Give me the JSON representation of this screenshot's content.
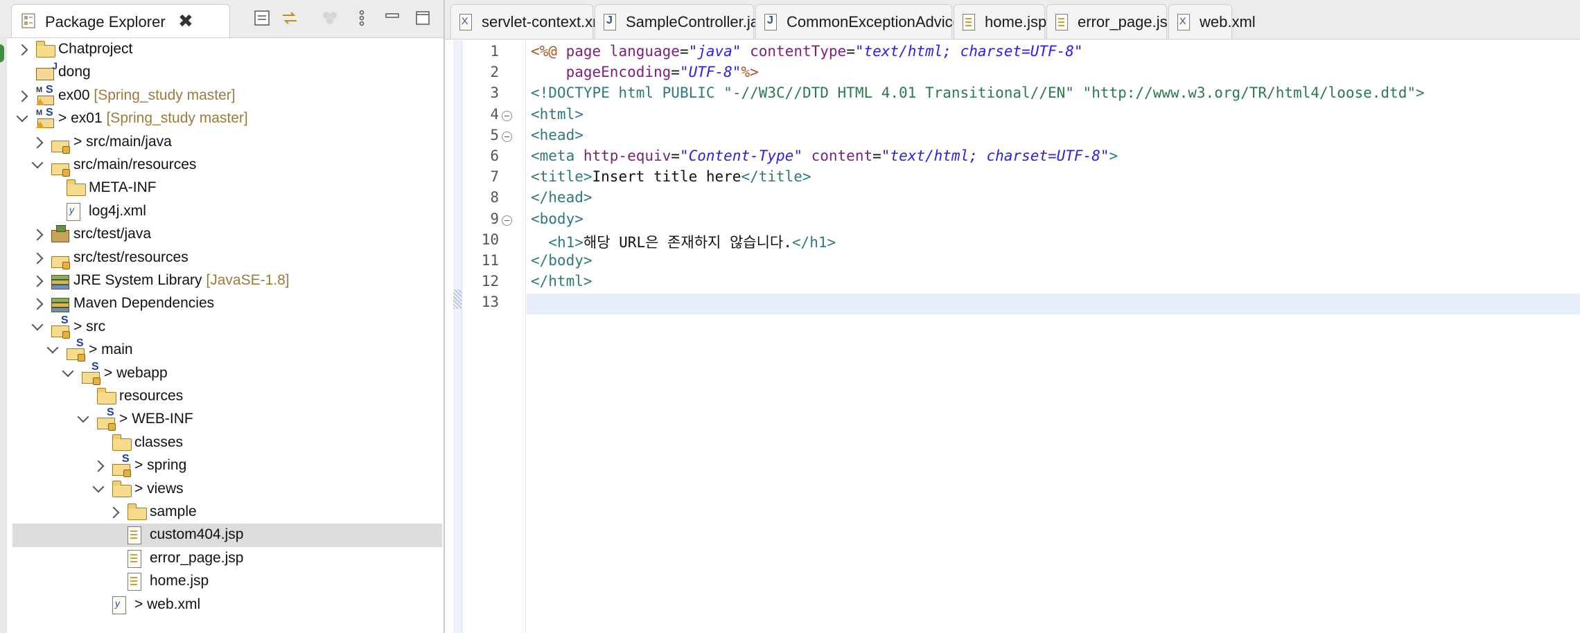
{
  "package_explorer": {
    "title": "Package Explorer",
    "tree": [
      {
        "label": "Chatproject",
        "suffix": "",
        "icon": "project-folder-icon",
        "depth": 0,
        "state": "collapsed"
      },
      {
        "label": "dong",
        "suffix": "",
        "icon": "java-project-icon",
        "depth": 0,
        "state": "none"
      },
      {
        "label": "ex00",
        "suffix": "[Spring_study master]",
        "icon": "maven-spring-project-icon",
        "depth": 0,
        "state": "collapsed"
      },
      {
        "label": "> ex01",
        "suffix": "[Spring_study master]",
        "icon": "maven-spring-project-icon",
        "depth": 0,
        "state": "expanded"
      },
      {
        "label": "> src/main/java",
        "suffix": "",
        "icon": "source-folder-icon",
        "depth": 1,
        "state": "collapsed"
      },
      {
        "label": "src/main/resources",
        "suffix": "",
        "icon": "source-folder-icon",
        "depth": 1,
        "state": "expanded"
      },
      {
        "label": "META-INF",
        "suffix": "",
        "icon": "folder-icon",
        "depth": 2,
        "state": "none"
      },
      {
        "label": "log4j.xml",
        "suffix": "",
        "icon": "xml-file-icon",
        "depth": 2,
        "state": "none"
      },
      {
        "label": "src/test/java",
        "suffix": "",
        "icon": "package-root-icon",
        "depth": 1,
        "state": "collapsed"
      },
      {
        "label": "src/test/resources",
        "suffix": "",
        "icon": "source-folder-icon",
        "depth": 1,
        "state": "collapsed"
      },
      {
        "label": "JRE System Library",
        "suffix": "[JavaSE-1.8]",
        "icon": "library-icon",
        "depth": 1,
        "state": "collapsed"
      },
      {
        "label": "Maven Dependencies",
        "suffix": "",
        "icon": "library-icon",
        "depth": 1,
        "state": "collapsed"
      },
      {
        "label": "> src",
        "suffix": "",
        "icon": "spring-folder-icon",
        "depth": 1,
        "state": "expanded"
      },
      {
        "label": "> main",
        "suffix": "",
        "icon": "spring-folder-icon",
        "depth": 2,
        "state": "expanded"
      },
      {
        "label": "> webapp",
        "suffix": "",
        "icon": "spring-folder-icon",
        "depth": 3,
        "state": "expanded"
      },
      {
        "label": "resources",
        "suffix": "",
        "icon": "folder-icon",
        "depth": 4,
        "state": "none"
      },
      {
        "label": "> WEB-INF",
        "suffix": "",
        "icon": "spring-folder-icon",
        "depth": 4,
        "state": "expanded"
      },
      {
        "label": "classes",
        "suffix": "",
        "icon": "folder-icon",
        "depth": 5,
        "state": "none"
      },
      {
        "label": "> spring",
        "suffix": "",
        "icon": "spring-folder-icon",
        "depth": 5,
        "state": "collapsed"
      },
      {
        "label": "> views",
        "suffix": "",
        "icon": "folder-icon",
        "depth": 5,
        "state": "expanded"
      },
      {
        "label": "sample",
        "suffix": "",
        "icon": "folder-icon",
        "depth": 6,
        "state": "collapsed"
      },
      {
        "label": "custom404.jsp",
        "suffix": "",
        "icon": "jsp-file-icon",
        "depth": 6,
        "state": "none",
        "selected": true
      },
      {
        "label": "error_page.jsp",
        "suffix": "",
        "icon": "jsp-file-icon",
        "depth": 6,
        "state": "none"
      },
      {
        "label": "home.jsp",
        "suffix": "",
        "icon": "jsp-file-icon",
        "depth": 6,
        "state": "none"
      },
      {
        "label": "> web.xml",
        "suffix": "",
        "icon": "xml-file-icon",
        "depth": 5,
        "state": "none"
      }
    ]
  },
  "editor": {
    "tabs": [
      {
        "label": "servlet-context.xml",
        "icon": "xml-file-icon"
      },
      {
        "label": "SampleController.java",
        "icon": "java-file-icon"
      },
      {
        "label": "CommonExceptionAdvice.java",
        "icon": "java-file-icon"
      },
      {
        "label": "home.jsp",
        "icon": "jsp-file-icon"
      },
      {
        "label": "error_page.jsp",
        "icon": "jsp-file-icon"
      },
      {
        "label": "web.xml",
        "icon": "xml-file-icon"
      }
    ],
    "line_numbers": [
      "1",
      "2",
      "3",
      "4",
      "5",
      "6",
      "7",
      "8",
      "9",
      "10",
      "11",
      "12",
      "13"
    ],
    "code": {
      "l1": [
        [
          "jspd",
          "<%@ "
        ],
        [
          "attr",
          "page "
        ],
        [
          "attr",
          "language"
        ],
        [
          "txt",
          "="
        ],
        [
          "val",
          "\"java\" "
        ],
        [
          "attr",
          "contentType"
        ],
        [
          "txt",
          "="
        ],
        [
          "val",
          "\"text/html; charset=UTF-8\""
        ]
      ],
      "l2": [
        [
          "txt",
          "    "
        ],
        [
          "attr",
          "pageEncoding"
        ],
        [
          "txt",
          "="
        ],
        [
          "val",
          "\"UTF-8\""
        ],
        [
          "jspd",
          "%>"
        ]
      ],
      "l3": [
        [
          "doct",
          "<!DOCTYPE html "
        ],
        [
          "doct",
          "PUBLIC "
        ],
        [
          "dstr",
          "\"-//W3C//DTD HTML 4.01 Transitional//EN\" "
        ],
        [
          "dstr",
          "\"http://www.w3.org/TR/html4/loose.dtd\""
        ],
        [
          "doct",
          ">"
        ]
      ],
      "l4": [
        [
          "tag",
          "<html>"
        ]
      ],
      "l5": [
        [
          "tag",
          "<head>"
        ]
      ],
      "l6": [
        [
          "tag",
          "<meta "
        ],
        [
          "attr",
          "http-equiv"
        ],
        [
          "txt",
          "="
        ],
        [
          "val",
          "\"Content-Type\" "
        ],
        [
          "attr",
          "content"
        ],
        [
          "txt",
          "="
        ],
        [
          "val",
          "\"text/html; charset=UTF-8\""
        ],
        [
          "tag",
          ">"
        ]
      ],
      "l7": [
        [
          "tag",
          "<title>"
        ],
        [
          "txt",
          "Insert title here"
        ],
        [
          "tag",
          "</title>"
        ]
      ],
      "l8": [
        [
          "tag",
          "</head>"
        ]
      ],
      "l9": [
        [
          "tag",
          "<body>"
        ]
      ],
      "l10": [
        [
          "txt",
          "  "
        ],
        [
          "tag",
          "<h1>"
        ],
        [
          "txt",
          "해당 URL은 존재하지 않습니다."
        ],
        [
          "tag",
          "</h1>"
        ]
      ],
      "l11": [
        [
          "tag",
          "</body>"
        ]
      ],
      "l12": [
        [
          "tag",
          "</html>"
        ]
      ],
      "l13": []
    }
  },
  "colors": {
    "tag": "#2e7a7a",
    "attr": "#7a1f7a",
    "value": "#2a1fe6",
    "jsp": "#b3521a",
    "selection": "#dcdcdc",
    "current_line": "#e8eef9",
    "branch": "#9c7a3a"
  }
}
